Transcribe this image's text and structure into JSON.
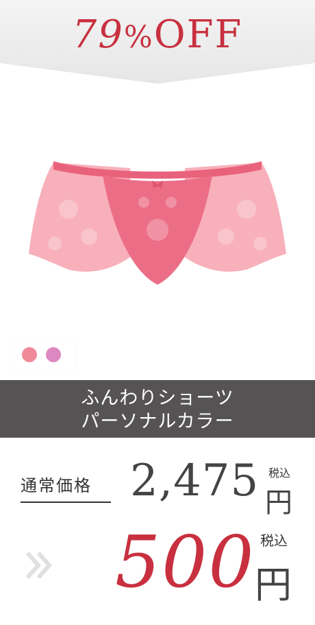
{
  "banner": {
    "discount_number": "79",
    "discount_percent": "%",
    "discount_word": "OFF",
    "accent_color": "#c8303f"
  },
  "product": {
    "image_icon": "panty-image",
    "swatch_colors": [
      "#f08a98",
      "#dd88c0"
    ],
    "name_line1": "ふんわりショーツ",
    "name_line2": "パーソナルカラー"
  },
  "pricing": {
    "regular_label": "通常価格",
    "regular_price": "2,475",
    "regular_currency": "円",
    "regular_tax": "税込",
    "arrow_icon": "double-chevron-right-icon",
    "sale_price": "500",
    "sale_currency": "円",
    "sale_tax": "税込"
  }
}
